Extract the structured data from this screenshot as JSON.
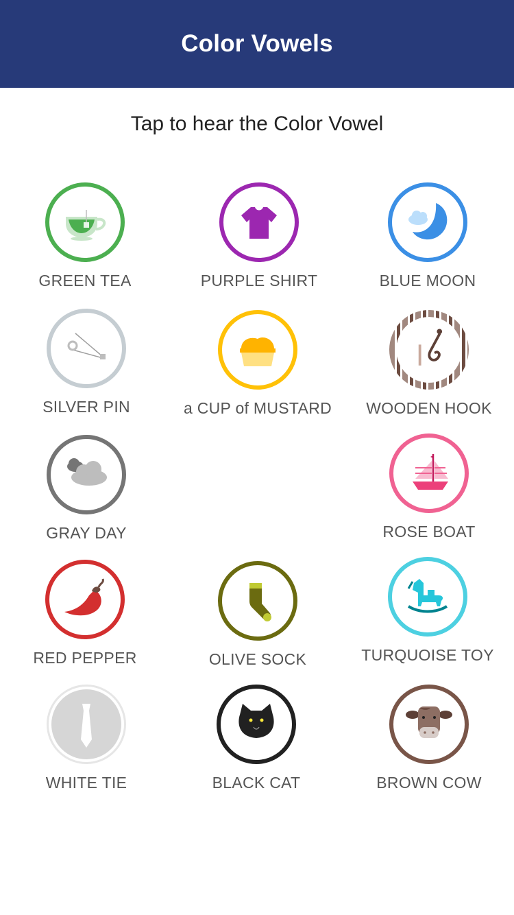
{
  "header": {
    "title": "Color Vowels"
  },
  "instructions": "Tap to hear the Color Vowel",
  "vowels": [
    {
      "label": "GREEN TEA",
      "icon": "green-tea-icon",
      "color": "#4caf50"
    },
    {
      "label": "PURPLE SHIRT",
      "icon": "purple-shirt-icon",
      "color": "#9c27b0"
    },
    {
      "label": "BLUE MOON",
      "icon": "blue-moon-icon",
      "color": "#3b8fe5"
    },
    {
      "label": "SILVER PIN",
      "icon": "silver-pin-icon",
      "color": "#b8c2c8"
    },
    {
      "label": "a CUP of MUSTARD",
      "icon": "cup-of-mustard-icon",
      "color": "#ffc107"
    },
    {
      "label": "WOODEN HOOK",
      "icon": "wooden-hook-icon",
      "color": "#8d6e63"
    },
    {
      "label": "GRAY DAY",
      "icon": "gray-day-icon",
      "color": "#757575"
    },
    {
      "label": "ROSE BOAT",
      "icon": "rose-boat-icon",
      "color": "#f06292"
    },
    {
      "label": "RED PEPPER",
      "icon": "red-pepper-icon",
      "color": "#d32f2f"
    },
    {
      "label": "OLIVE SOCK",
      "icon": "olive-sock-icon",
      "color": "#6b6b10"
    },
    {
      "label": "TURQUOISE TOY",
      "icon": "turquoise-toy-icon",
      "color": "#4dd0e1"
    },
    {
      "label": "WHITE TIE",
      "icon": "white-tie-icon",
      "color": "#e6e6e6"
    },
    {
      "label": "BLACK CAT",
      "icon": "black-cat-icon",
      "color": "#212121"
    },
    {
      "label": "BROWN COW",
      "icon": "brown-cow-icon",
      "color": "#795548"
    }
  ]
}
